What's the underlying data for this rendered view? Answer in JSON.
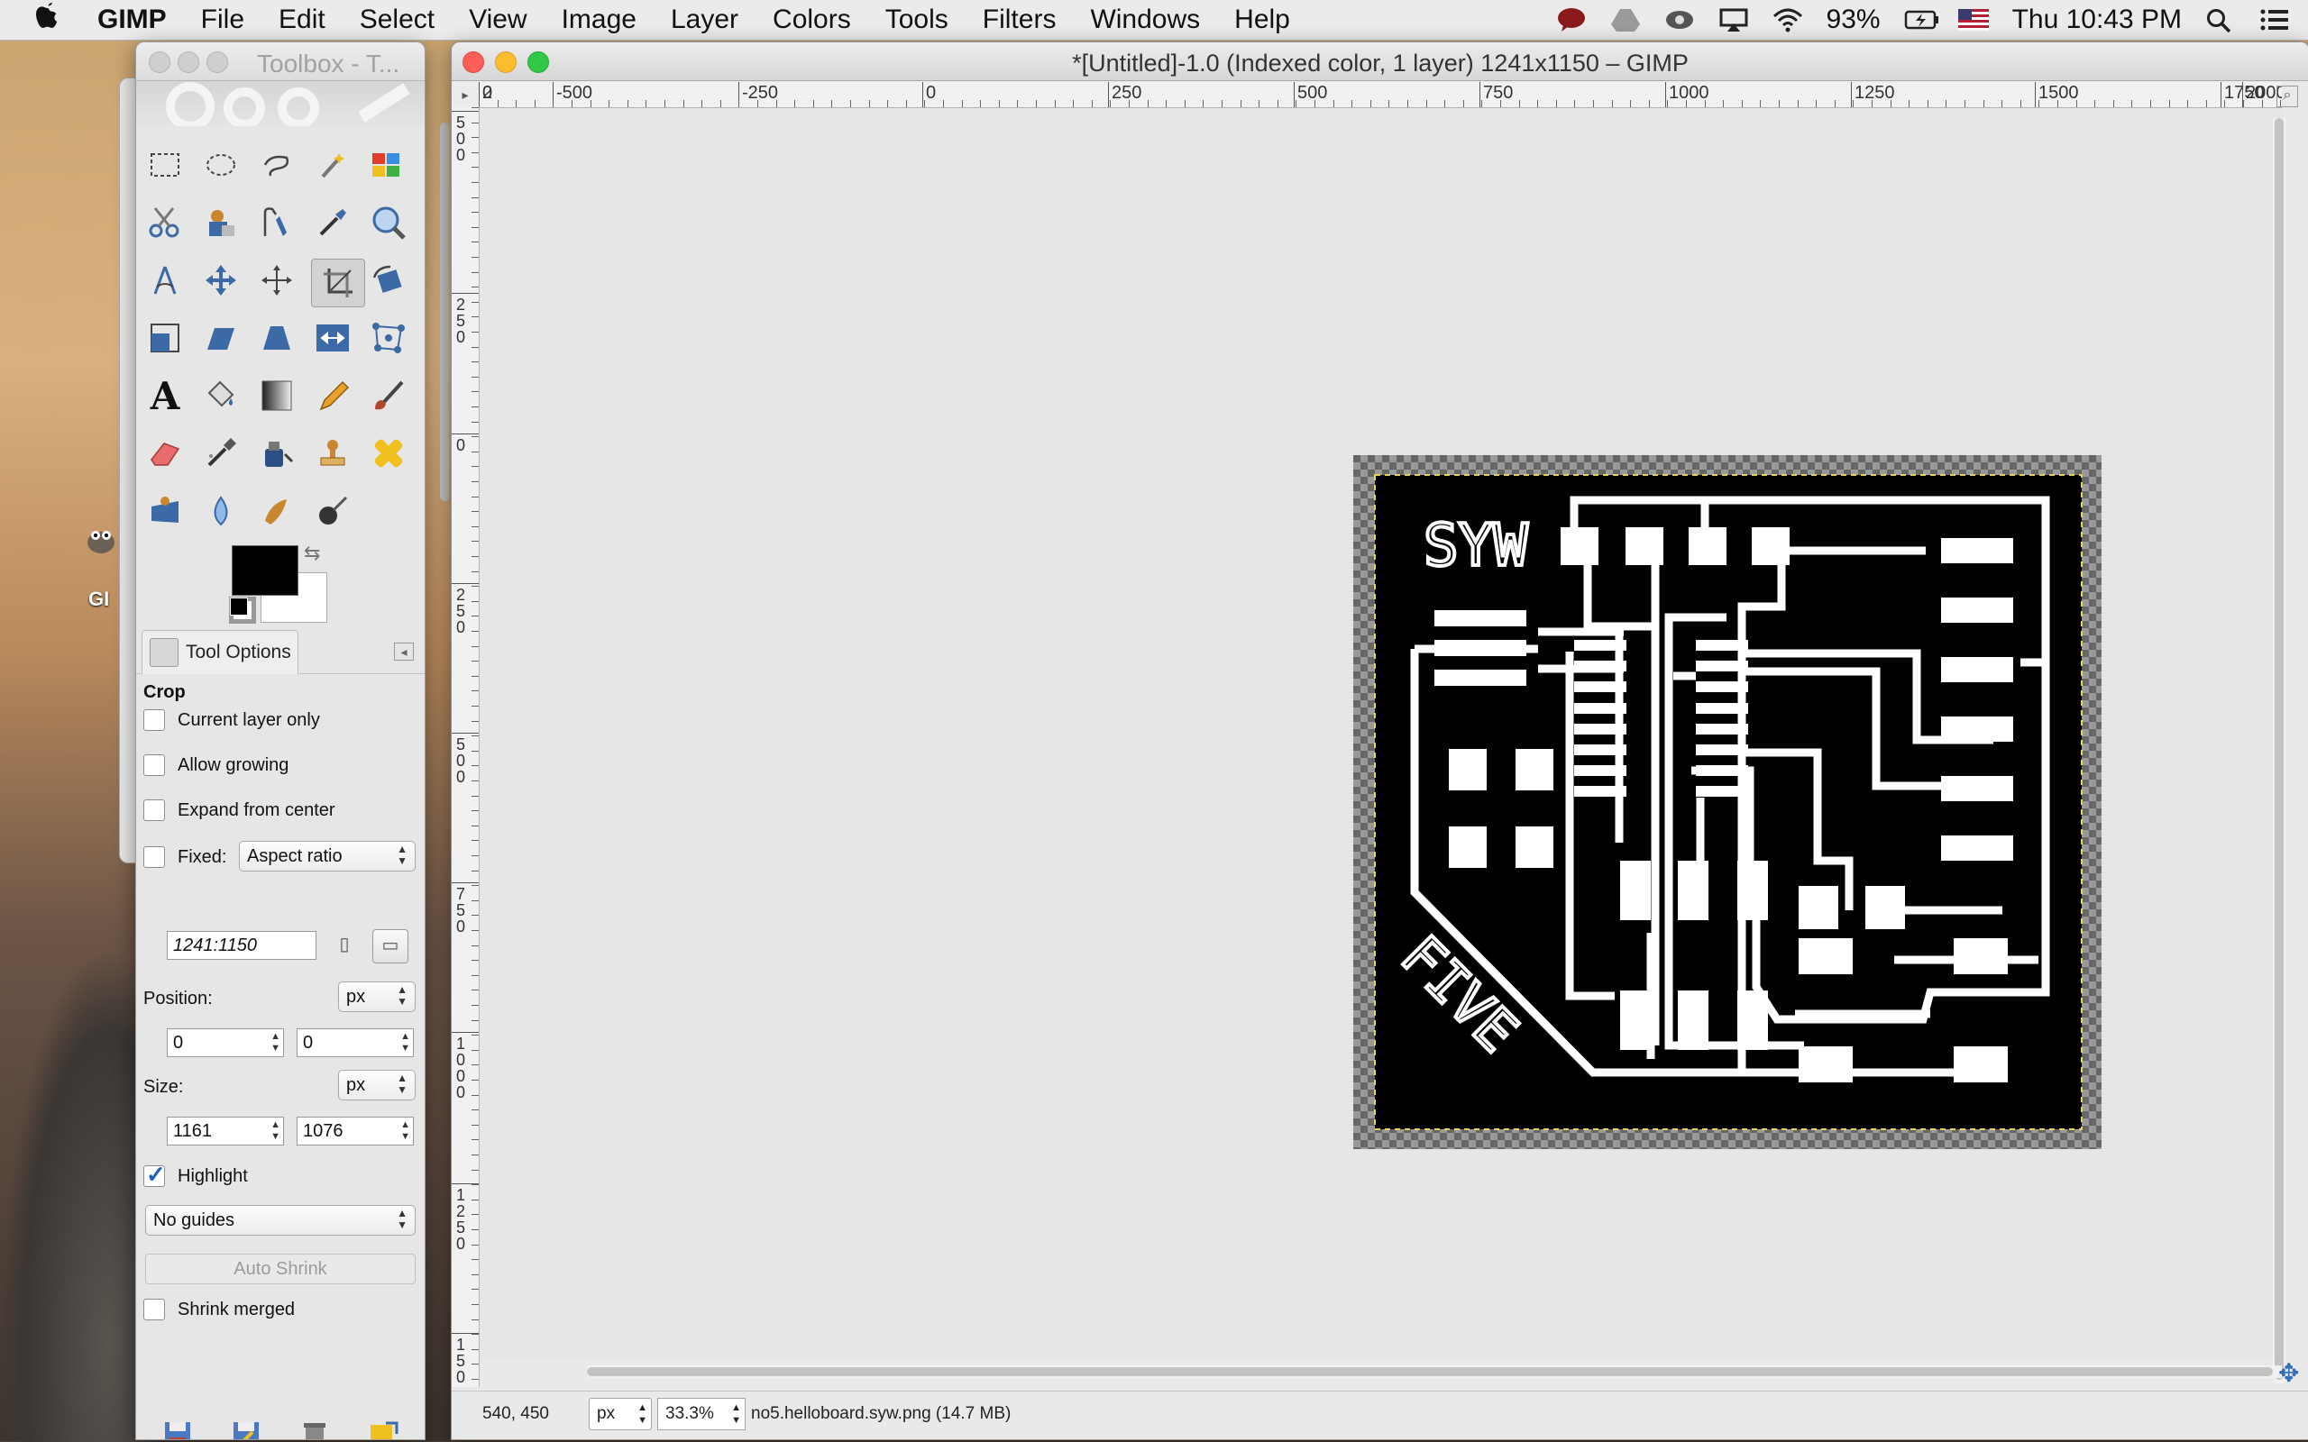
{
  "menubar": {
    "app": "GIMP",
    "items": [
      "File",
      "Edit",
      "Select",
      "View",
      "Image",
      "Layer",
      "Colors",
      "Tools",
      "Filters",
      "Windows",
      "Help"
    ],
    "battery": "93%",
    "clock": "Thu 10:43 PM"
  },
  "desktop": {
    "icon_label": "GI"
  },
  "toolbox": {
    "title": "Toolbox - T...",
    "tab_label": "Tool Options",
    "tool_name": "Crop",
    "options": {
      "current_layer_only": "Current layer only",
      "allow_growing": "Allow growing",
      "expand_from_center": "Expand from center",
      "fixed_label": "Fixed:",
      "fixed_mode": "Aspect ratio",
      "ratio_value": "1241:1150",
      "position_label": "Position:",
      "position_unit": "px",
      "position_x": "0",
      "position_y": "0",
      "size_label": "Size:",
      "size_unit": "px",
      "size_w": "1161",
      "size_h": "1076",
      "highlight": "Highlight",
      "guides": "No guides",
      "auto_shrink": "Auto Shrink",
      "shrink_merged": "Shrink merged"
    }
  },
  "image_window": {
    "title": "*[Untitled]-1.0 (Indexed color, 1 layer) 1241x1150 – GIMP",
    "hruler_labels": [
      "-500",
      "-250",
      "0",
      "250",
      "500",
      "750",
      "1000",
      "1250",
      "1500",
      "1750",
      "2000",
      "2"
    ],
    "vruler_labels": [
      [
        "5",
        "0",
        "0"
      ],
      [
        "2",
        "5",
        "0"
      ],
      [
        "0"
      ],
      [
        "2",
        "5",
        "0"
      ],
      [
        "5",
        "0",
        "0"
      ],
      [
        "7",
        "5",
        "0"
      ],
      [
        "1",
        "0",
        "0",
        "0"
      ],
      [
        "1",
        "2",
        "5",
        "0"
      ],
      [
        "1",
        "5",
        "0",
        "0"
      ]
    ],
    "board_text_top": "SYW",
    "board_text_bottom": "FIVE",
    "status": {
      "coords": "540, 450",
      "unit": "px",
      "zoom": "33.3%",
      "file": "no5.helloboard.syw.png (14.7 MB)"
    }
  }
}
